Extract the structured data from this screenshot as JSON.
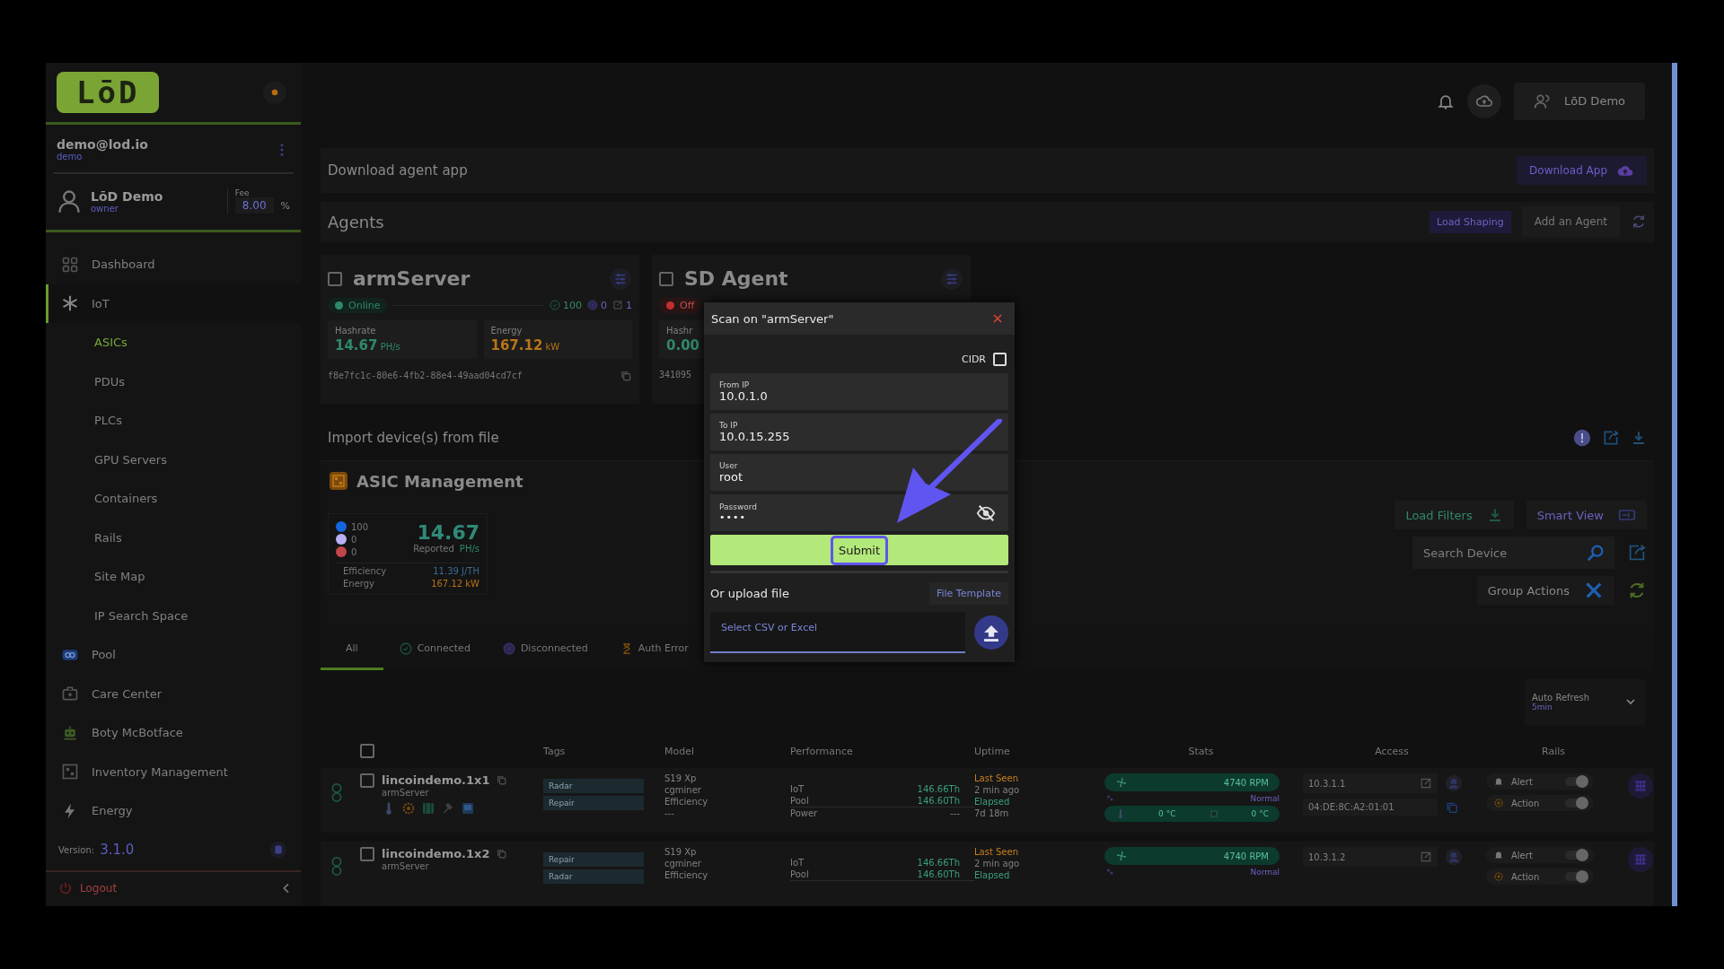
{
  "sidebar": {
    "logo": "LōD",
    "account": {
      "email": "demo@lod.io",
      "username": "demo"
    },
    "user": {
      "name": "LōD Demo",
      "role": "owner",
      "fee_label": "Fee",
      "fee": "8.00",
      "fee_unit": "%"
    },
    "nav": [
      {
        "label": "Dashboard",
        "kind": "dashboard",
        "selected": false
      },
      {
        "label": "IoT",
        "kind": "iot",
        "selected": true,
        "expanded": true,
        "children": [
          {
            "label": "ASICs",
            "selected": true
          },
          {
            "label": "PDUs",
            "selected": false
          },
          {
            "label": "PLCs",
            "selected": false
          },
          {
            "label": "GPU Servers",
            "selected": false
          },
          {
            "label": "Containers",
            "selected": false
          },
          {
            "label": "Rails",
            "selected": false
          },
          {
            "label": "Site Map",
            "selected": false
          },
          {
            "label": "IP Search Space",
            "selected": false
          }
        ]
      },
      {
        "label": "Pool",
        "kind": "pool",
        "selected": false
      },
      {
        "label": "Care Center",
        "kind": "care",
        "selected": false
      },
      {
        "label": "Boty McBotface",
        "kind": "bot",
        "selected": false
      },
      {
        "label": "Inventory Management",
        "kind": "inventory",
        "selected": false
      },
      {
        "label": "Energy",
        "kind": "energy",
        "selected": false
      }
    ],
    "version": {
      "label": "Version:",
      "value": "3.1.0"
    },
    "logout": "Logout"
  },
  "header": {
    "user_button": "LōD Demo"
  },
  "download_bar": {
    "title": "Download agent app",
    "button": "Download App"
  },
  "agents": {
    "title": "Agents",
    "buttons": [
      "Load Shaping",
      "Add an Agent"
    ],
    "cards": [
      {
        "name": "armServer",
        "checked": false,
        "status": "Online",
        "online": true,
        "counts": [
          "100",
          "0",
          "1"
        ],
        "hashrate_label": "Hashrate",
        "hashrate": "14.67",
        "hashrate_unit": "PH/s",
        "energy_label": "Energy",
        "energy": "167.12",
        "energy_unit": "kW",
        "id": "f8e7fc1c-80e6-4fb2-88e4-49aad04cd7cf"
      },
      {
        "name": "SD Agent",
        "checked": false,
        "status": "Off",
        "online": false,
        "hashrate_label": "Hashr",
        "hashrate": "0.00",
        "id": "341095"
      }
    ]
  },
  "import": {
    "title": "Import device(s) from file"
  },
  "asic": {
    "title": "ASIC Management",
    "counts": [
      {
        "value": "100",
        "color": "#1565e0"
      },
      {
        "value": "0",
        "color": "#b8b0f5"
      },
      {
        "value": "0",
        "color": "#c0464a"
      }
    ],
    "hashrate": "14.67",
    "reported_label": "Reported",
    "unit": "PH/s",
    "metrics": [
      {
        "label": "Efficiency",
        "value": "11.39 J/TH",
        "kind": "efficiency"
      },
      {
        "label": "Energy",
        "value": "167.12 kW",
        "kind": "energy"
      }
    ],
    "load_filters": "Load Filters",
    "smart_view": "Smart View",
    "search": {
      "placeholder": "Search Device"
    },
    "group_actions": "Group Actions"
  },
  "tabs": [
    {
      "label": "All",
      "selected": true,
      "kind": "all"
    },
    {
      "label": "Connected",
      "selected": false,
      "kind": "connected"
    },
    {
      "label": "Disconnected",
      "selected": false,
      "kind": "disconnected"
    },
    {
      "label": "Auth Error",
      "selected": false,
      "kind": "auth_error"
    }
  ],
  "auto_refresh": {
    "label": "Auto Refresh",
    "value": "5min"
  },
  "table": {
    "all_checked": false,
    "columns": [
      "Tags",
      "Model",
      "Performance",
      "Uptime",
      "Stats",
      "Access",
      "Rails"
    ],
    "rows": [
      {
        "checked": false,
        "name": "lincoindemo.1x1",
        "agent": "armServer",
        "tool_icons": true,
        "tags": [
          "Radar",
          "Repair"
        ],
        "model": [
          "S19 Xp",
          "cgminer",
          "Efficiency",
          "---"
        ],
        "performance": [
          {
            "label": "IoT",
            "value": "146.66Th"
          },
          {
            "label": "Pool",
            "value": "146.60Th"
          },
          {
            "label": "Power",
            "value": "---"
          }
        ],
        "uptime": [
          "Last Seen",
          "2 min ago",
          "Elapsed",
          "7d 18m"
        ],
        "fan": "4740 RPM",
        "fan_status": "Normal",
        "temps": [
          "0 °C",
          "0 °C"
        ],
        "ip": "10.3.1.1",
        "mac": "04:DE:8C:A2:01:01",
        "rails": [
          {
            "label": "Alert",
            "on": true
          },
          {
            "label": "Action",
            "on": true
          }
        ]
      },
      {
        "checked": false,
        "name": "lincoindemo.1x2",
        "agent": "armServer",
        "tags": [
          "Repair",
          "Radar"
        ],
        "model": [
          "S19 Xp",
          "cgminer",
          "Efficiency"
        ],
        "performance": [
          {
            "label": "IoT",
            "value": "146.66Th"
          },
          {
            "label": "Pool",
            "value": "146.60Th"
          }
        ],
        "uptime": [
          "Last Seen",
          "2 min ago",
          "Elapsed"
        ],
        "fan": "4740 RPM",
        "fan_status": "Normal",
        "ip": "10.3.1.2",
        "rails": [
          {
            "label": "Alert",
            "on": true
          },
          {
            "label": "Action",
            "on": true
          }
        ]
      }
    ]
  },
  "modal": {
    "title": "Scan on \"armServer\"",
    "cidr": {
      "label": "CIDR",
      "checked": false
    },
    "fields": [
      {
        "label": "From IP",
        "value": "10.0.1.0",
        "kind": "text"
      },
      {
        "label": "To IP",
        "value": "10.0.15.255",
        "kind": "text"
      },
      {
        "label": "User",
        "value": "root",
        "kind": "text"
      },
      {
        "label": "Password",
        "value": "••••",
        "kind": "password"
      }
    ],
    "submit": "Submit",
    "upload": {
      "title": "Or upload file",
      "template_button": "File Template",
      "placeholder": "Select CSV or Excel"
    }
  }
}
